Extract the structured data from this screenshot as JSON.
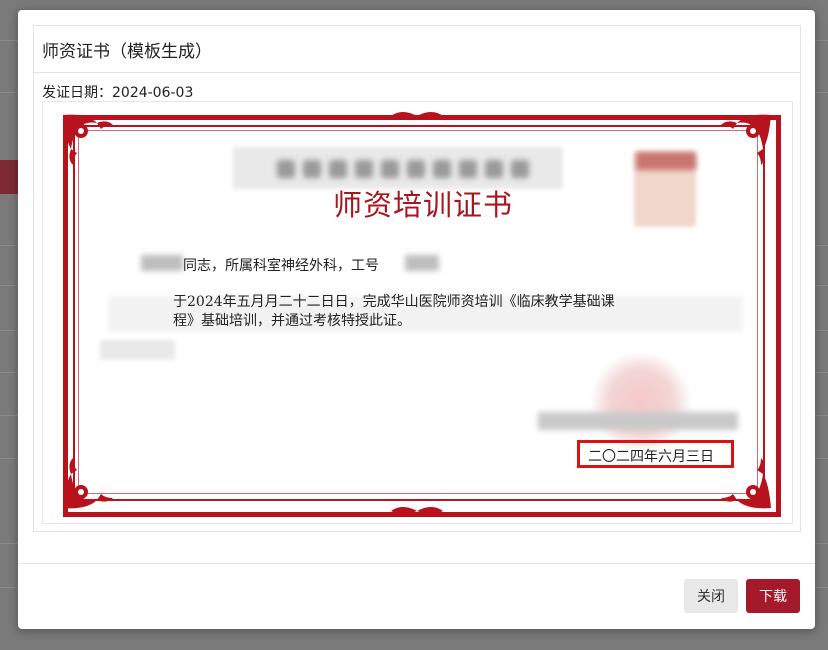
{
  "dialog": {
    "title": "师资证书（模板生成）",
    "issue_date_line": "发证日期：2024-06-03"
  },
  "certificate": {
    "title": "师资培训证书",
    "recipient_line": "同志，所属科室神经外科，工号",
    "body_line1": "于2024年五月月二十二日日，完成华山医院师资培训《临床教学基础课",
    "body_line2": "程》基础培训，并通过考核特授此证。",
    "date": "二〇二四年六月三日",
    "frame_color": "#b8121d",
    "highlight_color": "#e01010"
  },
  "footer": {
    "close_label": "关闭",
    "download_label": "下载",
    "download_color": "#a5192a"
  }
}
